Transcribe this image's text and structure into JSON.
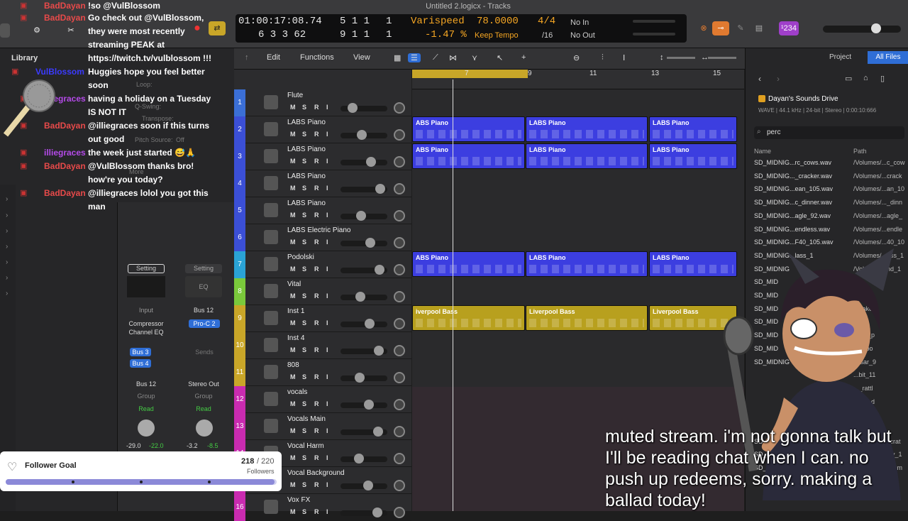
{
  "window": {
    "title": "Untitled 2.logicx - Tracks"
  },
  "lcd": {
    "time": "01:00:17:08.74",
    "time_sub": "6 3 3 62",
    "bars": "5 1 1",
    "bars_sub": "9 1 1",
    "beat_right": "1",
    "beat_right_sub": "1",
    "varispeed_label": "Varispeed",
    "varispeed_pct": "-1.47 %",
    "tempo": "78.0000",
    "tempo_mode": "Keep Tempo",
    "signature": "4/4",
    "division": "/16",
    "in_status": "No In",
    "out_status": "No Out",
    "count_badge": "¹234"
  },
  "library": {
    "title": "Library"
  },
  "inspector": {
    "loop": "Loop:",
    "qswing": "Q-Swing:",
    "transpose": "Transpose:",
    "pitch_source": "Pitch Source:",
    "pitch_source_val": "Off",
    "more": "More",
    "setting_left": "Setting",
    "setting_right": "Setting",
    "eq": "EQ",
    "input": "Input",
    "bus12_send": "Bus 12",
    "plugin1": "Compressor",
    "plugin2": "Channel EQ",
    "plugin_right": "Pro-C 2",
    "bus3": "Bus 3",
    "bus4": "Bus 4",
    "sends": "Sends",
    "out_left": "Bus 12",
    "out_right": "Stereo Out",
    "group_left": "Group",
    "group_right": "Group",
    "read_left": "Read",
    "read_right": "Read",
    "vol_left_a": "-29.0",
    "vol_left_b": "-22.0",
    "vol_right_a": "-3.2",
    "vol_right_b": "-8.5"
  },
  "toolbar": {
    "edit": "Edit",
    "functions": "Functions",
    "view": "View"
  },
  "ruler": [
    "7",
    "9",
    "11",
    "13",
    "15"
  ],
  "tracks": [
    {
      "num": "1",
      "name": "Flute",
      "color": "#3b6fd6"
    },
    {
      "num": "2",
      "name": "LABS Piano",
      "color": "#3b4fd6"
    },
    {
      "num": "3",
      "name": "LABS Piano",
      "color": "#3b4fd6"
    },
    {
      "num": "4",
      "name": "LABS Piano",
      "color": "#3b4fd6"
    },
    {
      "num": "5",
      "name": "LABS Piano",
      "color": "#3b4fd6"
    },
    {
      "num": "6",
      "name": "LABS Electric Piano",
      "color": "#3b4fd6"
    },
    {
      "num": "7",
      "name": "Podolski",
      "color": "#2aa3d6"
    },
    {
      "num": "8",
      "name": "Vital",
      "color": "#7ac93b"
    },
    {
      "num": "9",
      "name": "Inst 1",
      "color": "#c9a628"
    },
    {
      "num": "10",
      "name": "Inst 4",
      "color": "#c9a628"
    },
    {
      "num": "11",
      "name": "808",
      "color": "#c9a628"
    },
    {
      "num": "12",
      "name": "vocals",
      "color": "#c92bb0"
    },
    {
      "num": "13",
      "name": "Vocals Main",
      "color": "#c92bb0"
    },
    {
      "num": "14",
      "name": "Vocal Harm",
      "color": "#c92bb0"
    },
    {
      "num": "15",
      "name": "Vocal Background",
      "color": "#c92bb0"
    },
    {
      "num": "16",
      "name": "Vox FX",
      "color": "#c92bb0"
    }
  ],
  "track_buttons": {
    "m": "M",
    "s": "S",
    "r": "R",
    "i": "I"
  },
  "regions": {
    "piano": "LABS Piano",
    "piano_cut": "ABS Piano",
    "bass": "Liverpool Bass",
    "bass_cut": "iverpool Bass"
  },
  "browser": {
    "tab_project": "Project",
    "tab_all": "All Files",
    "drive": "Dayan's Sounds Drive",
    "drive_info": "WAVE | 44.1 kHz | 24-bit | Stereo | 0:00:10:666",
    "search": "perc",
    "col_name": "Name",
    "col_path": "Path",
    "files": [
      {
        "name": "SD_MIDNIG...rc_cows.wav",
        "path": "/Volumes/...c_cow"
      },
      {
        "name": "SD_MIDNIG..._cracker.wav",
        "path": "/Volumes/...crack"
      },
      {
        "name": "SD_MIDNIG...ean_105.wav",
        "path": "/Volumes/...an_10"
      },
      {
        "name": "SD_MIDNIG...c_dinner.wav",
        "path": "/Volumes/..._dinn"
      },
      {
        "name": "SD_MIDNIG...agle_92.wav",
        "path": "/Volumes/...agle_"
      },
      {
        "name": "SD_MIDNIG...endless.wav",
        "path": "/Volumes/...endle"
      },
      {
        "name": "SD_MIDNIG...F40_105.wav",
        "path": "/Volumes/...40_10"
      },
      {
        "name": "SD_MIDNIG...lass_1",
        "path": "/Volumes/...ass_1"
      },
      {
        "name": "SD_MIDNIG",
        "path": "/Volumes/...nd_1"
      },
      {
        "name": "SD_MID",
        "path": "...ti"
      },
      {
        "name": "SD_MID",
        "path": "...13_1"
      },
      {
        "name": "SD_MID",
        "path": "...hake"
      },
      {
        "name": "SD_MID",
        "path": "...thir"
      },
      {
        "name": "SD_MID",
        "path": "...erc_p"
      },
      {
        "name": "SD_MID",
        "path": "...ngpo"
      },
      {
        "name": "SD_MIDNIG",
        "path": "...lsar_9"
      },
      {
        "name": "",
        "path": "...bit_11"
      },
      {
        "name": "",
        "path": "..._rattl"
      },
      {
        "name": "",
        "path": "...rim_d"
      },
      {
        "name": "",
        "path": "...ter_9"
      },
      {
        "name": "",
        "path": "...erc_1"
      },
      {
        "name": "SD_MIDNIG",
        "path": "/Volumes/...scrat"
      },
      {
        "name": "SD_MIDNIG",
        "path": "/Volumes/...lby_1"
      },
      {
        "name": "SD_MIDNIG",
        "path": "/Volumes/...himm"
      }
    ]
  },
  "chat": [
    {
      "user": "BadDayan",
      "msg": "!so @VulBlossom"
    },
    {
      "user": "BadDayan",
      "msg": "Go check out @VulBlossom, they were most recently streaming PEAK at https://twitch.tv/vulblossom !!!"
    },
    {
      "user": "VulBlossom",
      "msg": "Huggies hope you feel better soon"
    },
    {
      "user": "illiegraces",
      "msg": "having a holiday on a Tuesday IS NOT IT"
    },
    {
      "user": "BadDayan",
      "msg": "@illiegraces soon if this turns out good"
    },
    {
      "user": "illiegraces",
      "msg": "the week just started 😅🙏"
    },
    {
      "user": "BadDayan",
      "msg": "@VulBlossom thanks bro! how're you today?"
    },
    {
      "user": "BadDayan",
      "msg": "@illiegraces lolol you got this man"
    }
  ],
  "goal": {
    "title": "Follower Goal",
    "current": "218",
    "target": "/ 220",
    "unit": "Followers",
    "progress": 0.991
  },
  "subtitle": "muted stream. i'm not gonna talk but I'll be reading chat when I can. no push up redeems, sorry. making a ballad today!"
}
